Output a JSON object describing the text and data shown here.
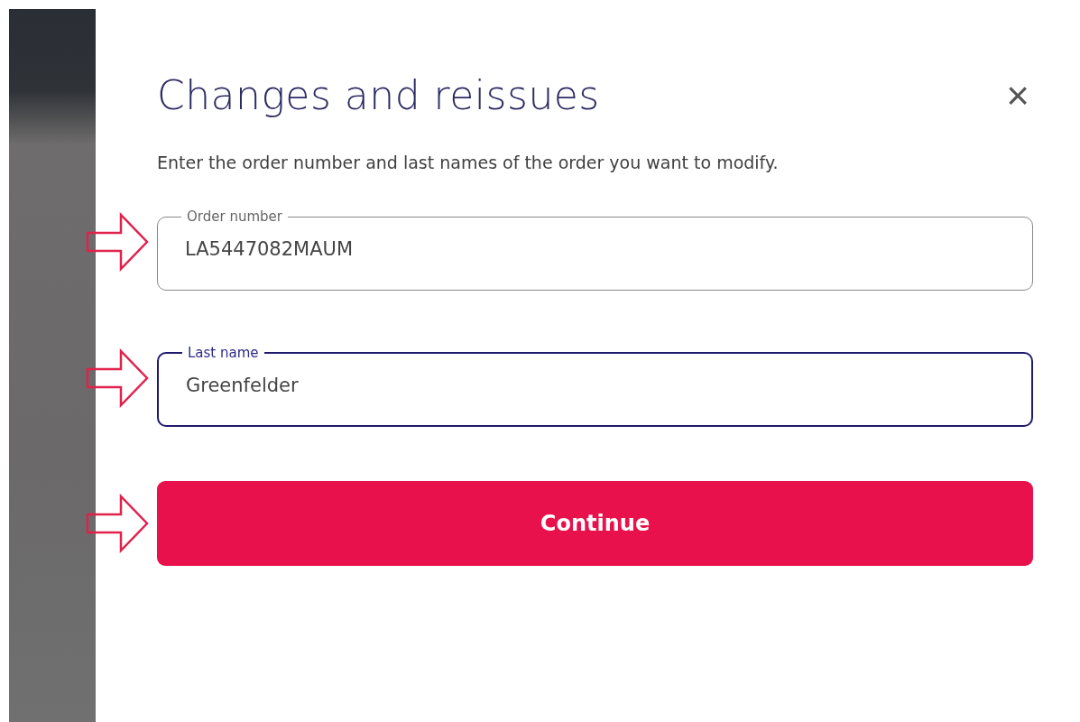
{
  "dialog": {
    "title": "Changes and reissues",
    "close": "×",
    "instructions": "Enter the order number and last names of the order you want to modify.",
    "fields": [
      {
        "label": "Order number",
        "value": "LA5447082MAUM",
        "focused": false,
        "marked": true
      },
      {
        "label": "Last name",
        "value": "Greenfelder",
        "focused": true,
        "marked": true
      }
    ],
    "button": {
      "label": "Continue",
      "marked": true
    }
  }
}
